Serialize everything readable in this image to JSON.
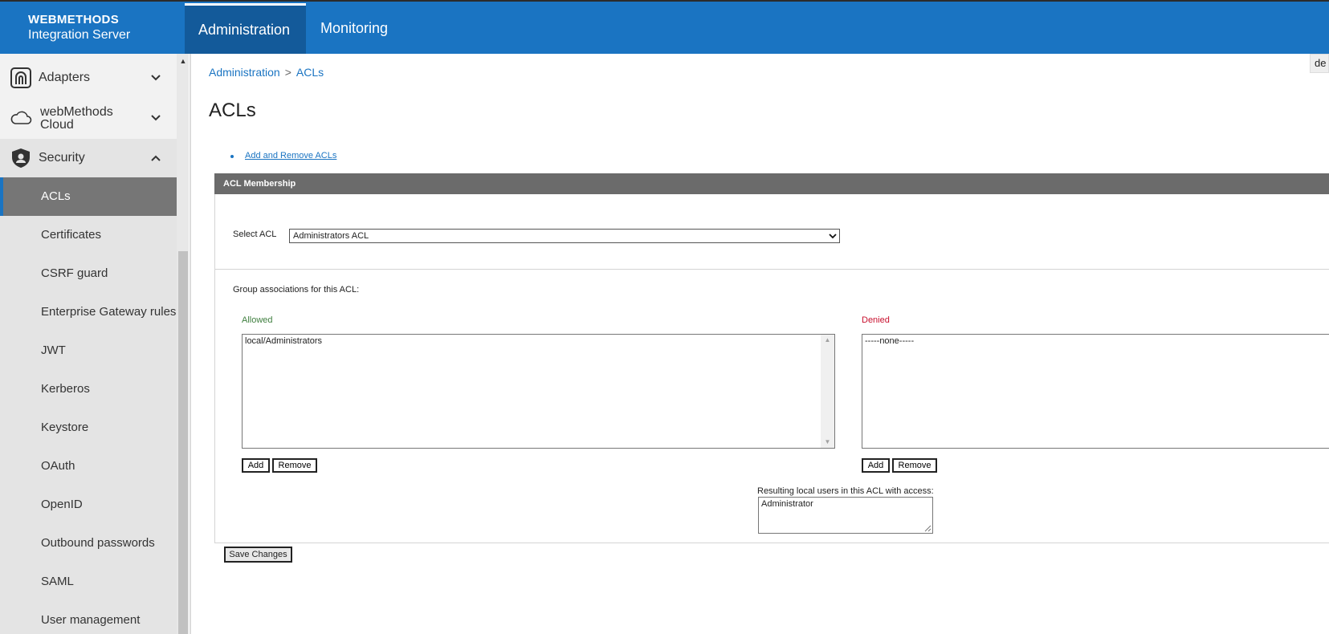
{
  "header": {
    "brand_line1": "WEBMETHODS",
    "brand_line2": "Integration Server",
    "tabs": [
      {
        "label": "Administration",
        "active": true
      },
      {
        "label": "Monitoring",
        "active": false
      }
    ]
  },
  "sidebar": {
    "sections": [
      {
        "label": "Adapters",
        "icon": "adapters-icon",
        "expanded": false
      },
      {
        "label": "webMethods Cloud",
        "label_line1": "webMethods",
        "label_line2": "Cloud",
        "icon": "cloud-icon",
        "expanded": false
      },
      {
        "label": "Security",
        "icon": "shield-icon",
        "expanded": true
      }
    ],
    "security_items": [
      {
        "label": "ACLs",
        "active": true
      },
      {
        "label": "Certificates"
      },
      {
        "label": "CSRF guard"
      },
      {
        "label": "Enterprise Gateway rules"
      },
      {
        "label": "JWT"
      },
      {
        "label": "Kerberos"
      },
      {
        "label": "Keystore"
      },
      {
        "label": "OAuth"
      },
      {
        "label": "OpenID"
      },
      {
        "label": "Outbound passwords"
      },
      {
        "label": "SAML"
      },
      {
        "label": "User management"
      }
    ]
  },
  "breadcrumb": {
    "items": [
      "Administration",
      "ACLs"
    ],
    "separator": ">"
  },
  "page_title": "ACLs",
  "corner_button": "de",
  "links": {
    "add_remove": "Add and Remove ACLs"
  },
  "panel": {
    "title": "ACL Membership",
    "select_label": "Select ACL",
    "select_value": "Administrators ACL",
    "group_assoc_label": "Group associations for this ACL:",
    "allowed": {
      "label": "Allowed",
      "color": "#3f7f3f",
      "items": [
        "local/Administrators"
      ],
      "add": "Add",
      "remove": "Remove"
    },
    "denied": {
      "label": "Denied",
      "color": "#c8102e",
      "items": [
        "-----none-----"
      ],
      "add": "Add",
      "remove": "Remove"
    },
    "result_label": "Resulting local users in this ACL with access:",
    "result_value": "Administrator"
  },
  "save_label": "Save Changes",
  "colors": {
    "accent": "#1a74c2",
    "header_bg": "#1a74c2",
    "active_tab": "#135a9a",
    "panel_head": "#6b6b6b"
  }
}
